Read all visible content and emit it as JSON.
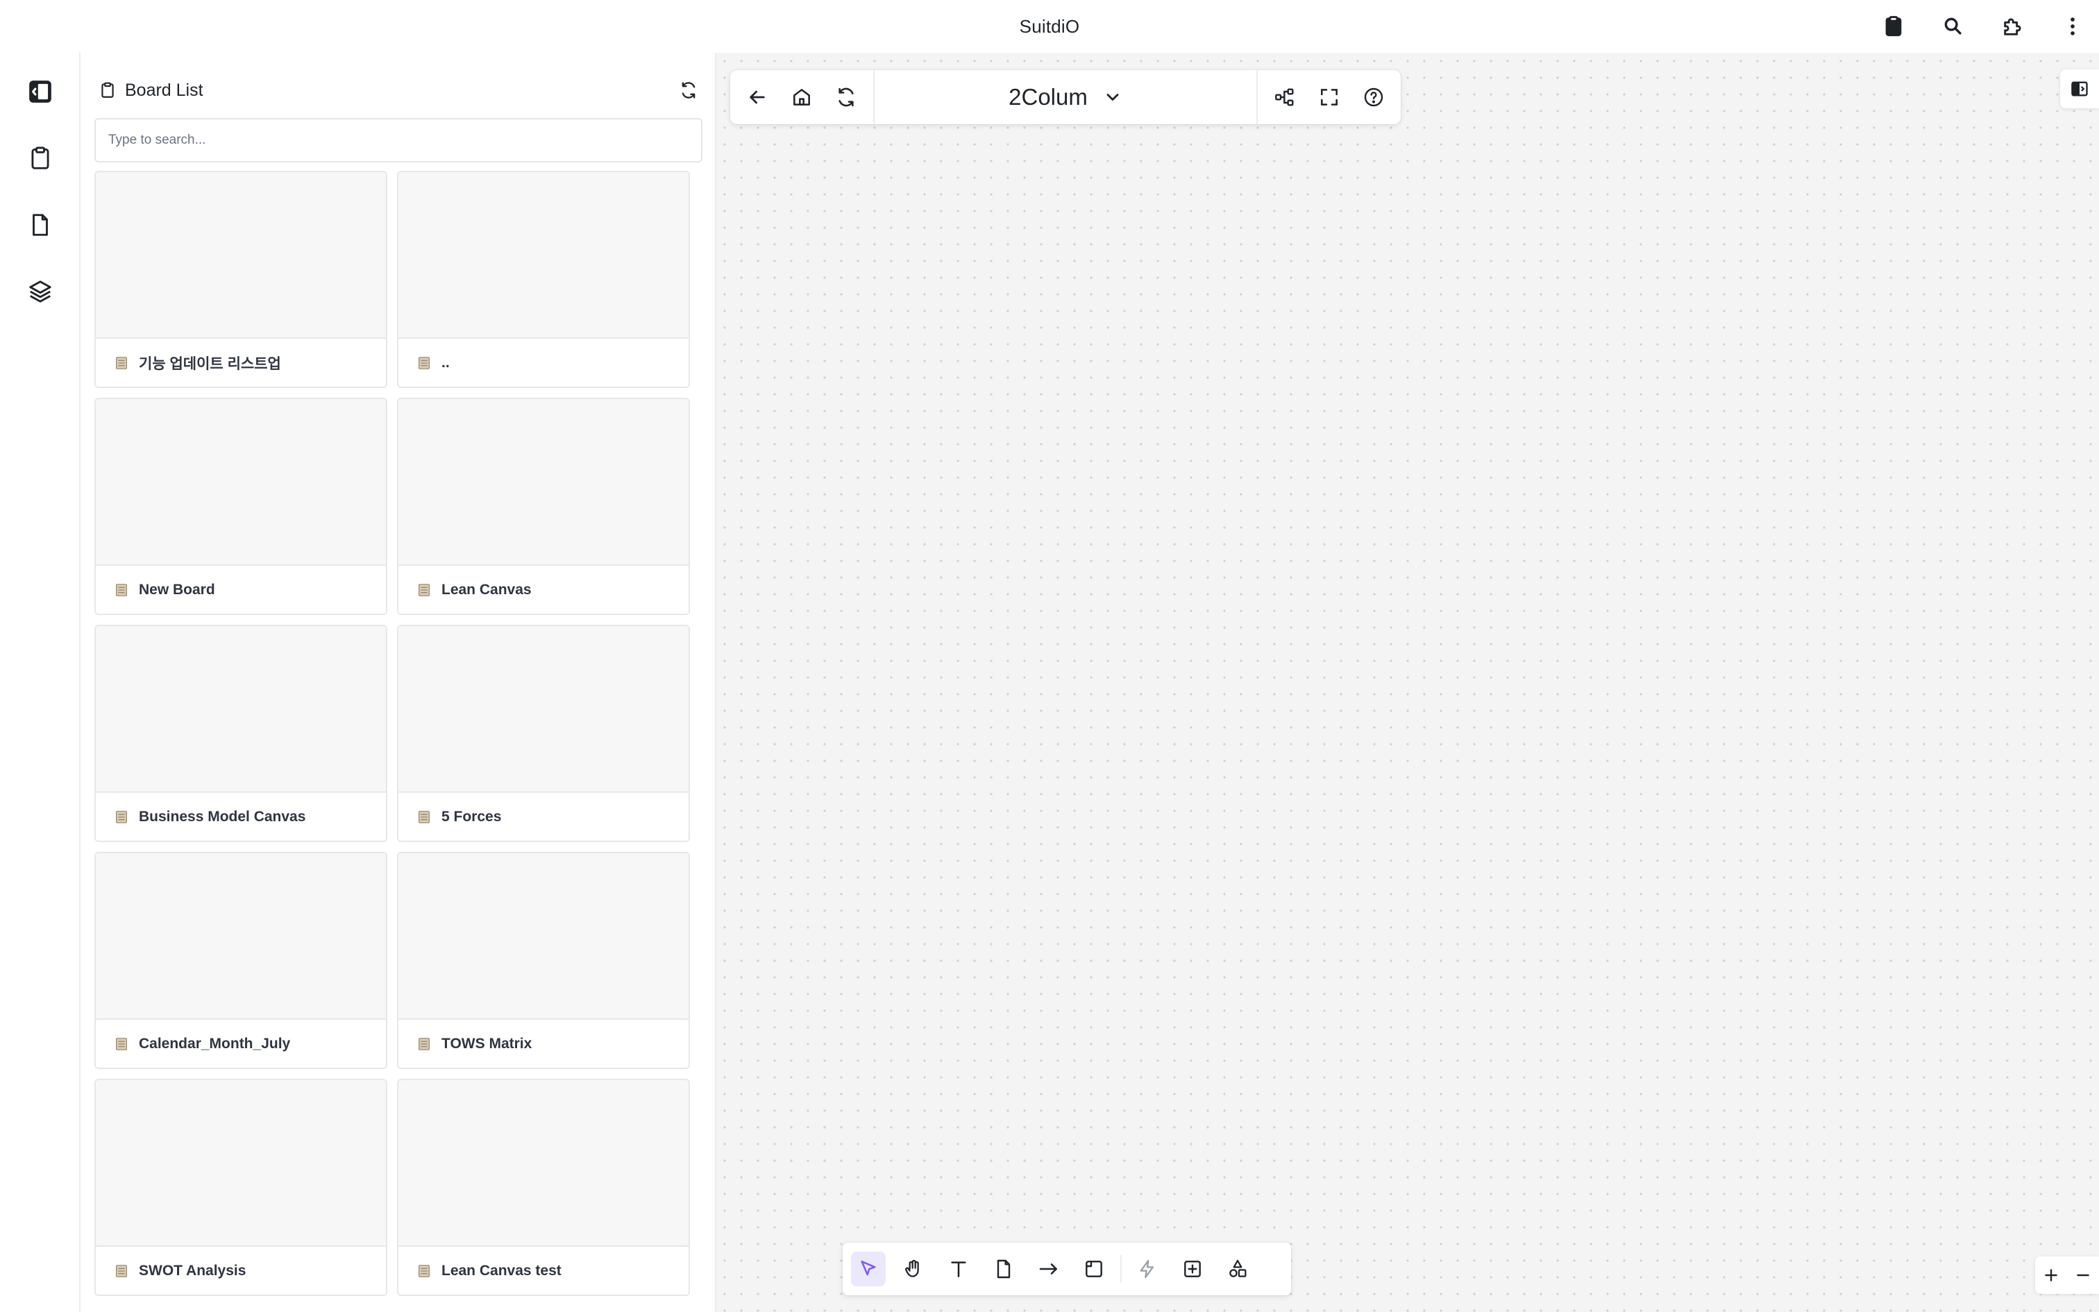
{
  "app": {
    "title": "SuitdiO"
  },
  "titlebar_icons": [
    "clipboard-icon",
    "search-icon",
    "puzzle-icon",
    "more-vertical-icon"
  ],
  "rail": {
    "items": [
      "sidebar-collapse-icon",
      "clipboard-icon",
      "file-icon",
      "layers-icon"
    ]
  },
  "board_list": {
    "title": "Board List",
    "search_placeholder": "Type to search...",
    "boards": [
      {
        "name": "기능 업데이트 리스트업"
      },
      {
        "name": ".."
      },
      {
        "name": "New Board"
      },
      {
        "name": "Lean Canvas"
      },
      {
        "name": "Business Model Canvas"
      },
      {
        "name": "5 Forces"
      },
      {
        "name": "Calendar_Month_July"
      },
      {
        "name": "TOWS Matrix"
      },
      {
        "name": "SWOT Analysis"
      },
      {
        "name": "Lean Canvas test"
      }
    ]
  },
  "canvas": {
    "board_name": "2Colum",
    "accent_color": "#7c5cf2",
    "bottom_tools": [
      "select-tool-icon",
      "hand-tool-icon",
      "text-tool-icon",
      "note-tool-icon",
      "arrow-tool-icon",
      "frame-tool-icon",
      "lightning-tool-icon",
      "add-block-tool-icon",
      "shapes-tool-icon"
    ],
    "selected_tool": "select-tool-icon"
  }
}
